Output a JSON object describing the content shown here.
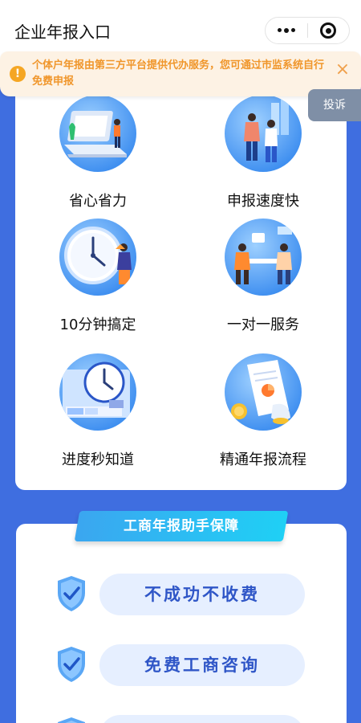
{
  "header": {
    "title": "企业年报入口"
  },
  "notice": {
    "text": "个体户年报由第三方平台提供代办服务，您可通过市监系统自行免费申报",
    "close_icon": "close-icon"
  },
  "complaint": {
    "label": "投诉"
  },
  "features": [
    {
      "label": "省心省力",
      "icon": "laptop-person-icon"
    },
    {
      "label": "申报速度快",
      "icon": "people-rising-icon"
    },
    {
      "label": "10分钟搞定",
      "icon": "clock-icon"
    },
    {
      "label": "一对一服务",
      "icon": "meeting-icon"
    },
    {
      "label": "进度秒知道",
      "icon": "progress-clock-icon"
    },
    {
      "label": "精通年报流程",
      "icon": "document-coin-icon"
    }
  ],
  "guarantee": {
    "title": "工商年报助手保障",
    "items": [
      "不成功不收费",
      "免费工商咨询",
      ""
    ]
  },
  "colors": {
    "page_bg": "#3f6ee0",
    "notice_bg": "#fdf2e4",
    "notice_text": "#f0962b",
    "pill_bg": "#e6efff",
    "pill_text": "#2f56c7"
  }
}
